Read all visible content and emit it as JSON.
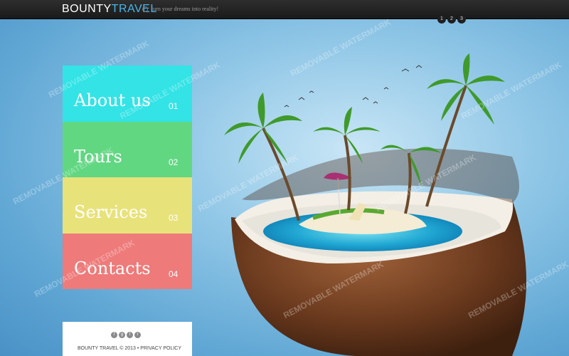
{
  "header": {
    "logo_part1": "BOUNTY",
    "logo_part2": "TRAVEL",
    "slogan": "turn your dreams into reality!",
    "slides": [
      "1",
      "2",
      "3"
    ]
  },
  "menu": [
    {
      "label": "About us",
      "number": "01",
      "color": "#33e3e6"
    },
    {
      "label": "Tours",
      "number": "02",
      "color": "#61d782"
    },
    {
      "label": "Services",
      "number": "03",
      "color": "#e8e27b"
    },
    {
      "label": "Contacts",
      "number": "04",
      "color": "#ee7a7a"
    }
  ],
  "footer": {
    "copyright": "BOUNTY TRAVEL © 2013",
    "separator": "•",
    "privacy": "PRIVACY POLICY",
    "social_icons": [
      "facebook-icon",
      "google-plus-icon",
      "twitter-icon",
      "rss-icon"
    ],
    "social_glyphs": [
      "f",
      "g",
      "t",
      "r"
    ]
  },
  "watermark": "REMOVABLE WATERMARK",
  "colors": {
    "accent": "#47b5e8"
  }
}
